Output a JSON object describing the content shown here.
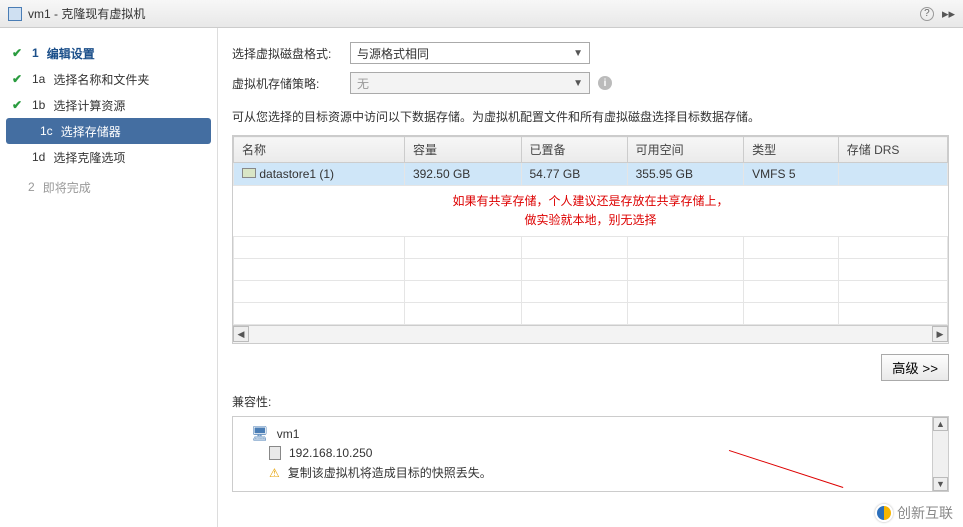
{
  "titlebar": {
    "title": "vm1 - 克隆现有虚拟机",
    "help_icon": "?",
    "next_icon": "▸▸"
  },
  "sidebar": {
    "step1": "编辑设置",
    "step1a": "选择名称和文件夹",
    "step1b": "选择计算资源",
    "step1c": "选择存储器",
    "step1d": "选择克隆选项",
    "step2": "即将完成",
    "num1": "1",
    "num1a": "1a",
    "num1b": "1b",
    "num1c": "1c",
    "num1d": "1d",
    "num2": "2"
  },
  "form": {
    "disk_format_label": "选择虚拟磁盘格式:",
    "disk_format_value": "与源格式相同",
    "storage_policy_label": "虚拟机存储策略:",
    "storage_policy_value": "无",
    "desc": "可从您选择的目标资源中访问以下数据存储。为虚拟机配置文件和所有虚拟磁盘选择目标数据存储。"
  },
  "table": {
    "headers": {
      "name": "名称",
      "capacity": "容量",
      "provisioned": "已置备",
      "free": "可用空间",
      "type": "类型",
      "drs": "存储 DRS"
    },
    "row": {
      "name": "datastore1 (1)",
      "capacity": "392.50 GB",
      "provisioned": "54.77 GB",
      "free": "355.95 GB",
      "type": "VMFS 5",
      "drs": ""
    }
  },
  "note": {
    "line1": "如果有共享存储，个人建议还是存放在共享存储上，",
    "line2": "做实验就本地，别无选择"
  },
  "advanced_button": "高级 >>",
  "compat": {
    "label": "兼容性:",
    "vm": "vm1",
    "host": "192.168.10.250",
    "warn": "复制该虚拟机将造成目标的快照丢失。"
  },
  "watermark": "创新互联"
}
